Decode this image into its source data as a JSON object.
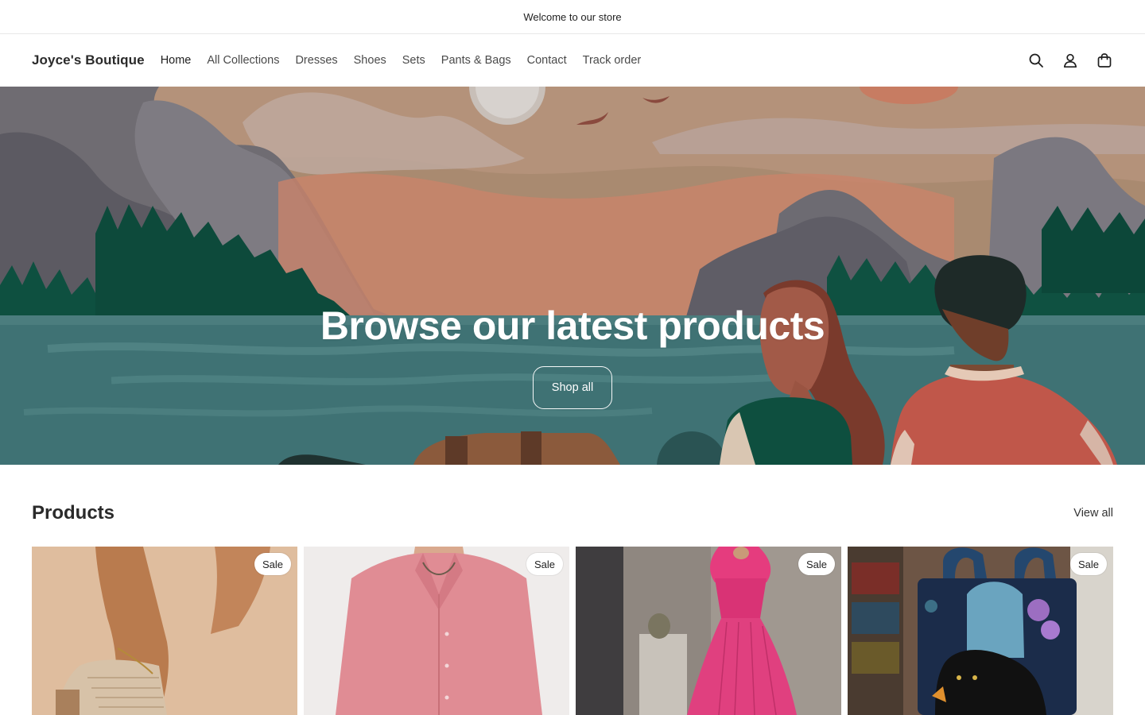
{
  "announcement": {
    "text": "Welcome to our store"
  },
  "header": {
    "logo": "Joyce's Boutique",
    "nav": [
      {
        "label": "Home"
      },
      {
        "label": "All Collections"
      },
      {
        "label": "Dresses"
      },
      {
        "label": "Shoes"
      },
      {
        "label": "Sets"
      },
      {
        "label": "Pants & Bags"
      },
      {
        "label": "Contact"
      },
      {
        "label": "Track order"
      }
    ],
    "icons": [
      "search-icon",
      "account-icon",
      "cart-icon"
    ]
  },
  "hero": {
    "title": "Browse our latest products",
    "button_label": "Shop all"
  },
  "products": {
    "title": "Products",
    "view_all": "View all",
    "items": [
      {
        "badge": "Sale",
        "image": "beige-heeled-sandal-on-leg"
      },
      {
        "badge": "Sale",
        "image": "pink-button-down-shirt"
      },
      {
        "badge": "Sale",
        "image": "magenta-pleated-maxi-dress"
      },
      {
        "badge": "Sale",
        "image": "quilted-black-cat-tote-bag"
      }
    ]
  },
  "colors": {
    "accent": "#1f1f1f",
    "hero_sky": "#a98a70",
    "hero_water": "#3f7274",
    "sale_badge_bg": "#ffffff"
  }
}
